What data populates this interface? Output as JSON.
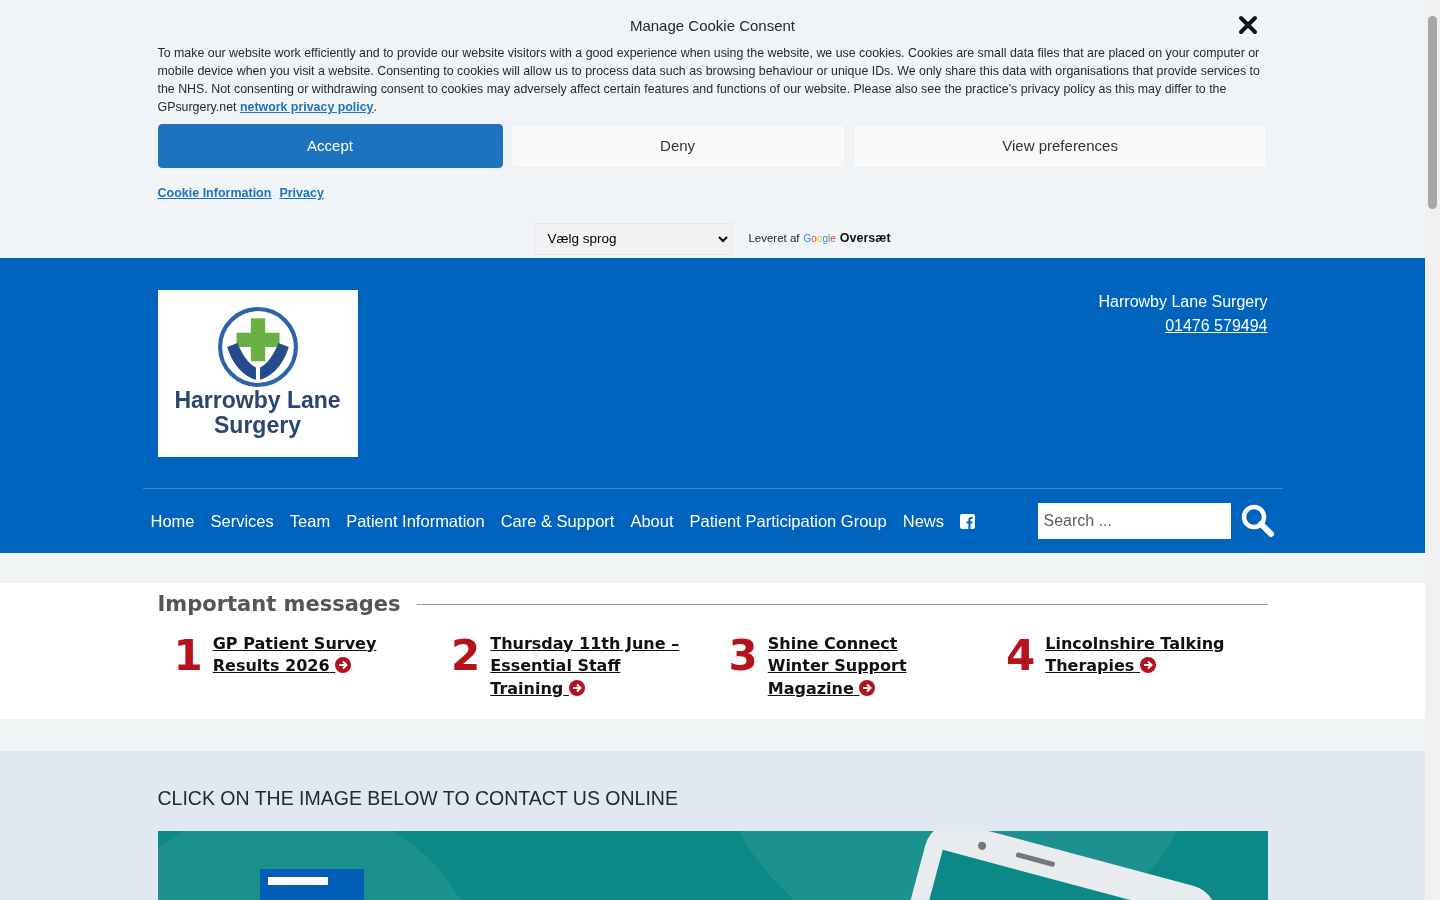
{
  "cookie_banner": {
    "title": "Manage Cookie Consent",
    "text_before": "To make our website work efficiently and to provide our website visitors with a good experience when using the website, we use cookies. Cookies are small data files that are placed on your computer or mobile device when you visit a website. Consenting to cookies will allow us to process data such as browsing behaviour or unique IDs. We only share this data with organisations that provide services to the NHS. Not consenting or withdrawing consent to cookies may adversely affect certain features and functions of our website. Please also see the practice’s privacy policy as this may differ to the GPsurgery.net ",
    "link": "network privacy policy",
    "text_after": ".",
    "buttons": [
      {
        "label": "Accept",
        "kind": "primary"
      },
      {
        "label": "Deny",
        "kind": "secondary"
      },
      {
        "label": "View preferences",
        "kind": "secondary"
      }
    ],
    "links": [
      "Cookie Information",
      "Privacy"
    ]
  },
  "translate": {
    "select_value": "Vælg sprog",
    "powered_by": "Leveret af",
    "provider": "Google",
    "action": "Oversæt"
  },
  "header": {
    "logo_lines": [
      "Harrowby Lane",
      "Surgery"
    ],
    "name": "Harrowby Lane Surgery",
    "phone": "01476 579494"
  },
  "nav": {
    "items": [
      "Home",
      "Services",
      "Team",
      "Patient Information",
      "Care & Support",
      "About",
      "Patient Participation Group",
      "News"
    ],
    "search_placeholder": "Search ..."
  },
  "messages": {
    "title": "Important messages",
    "items": [
      {
        "number": "1",
        "title": "GP Patient Survey Results 2026"
      },
      {
        "number": "2",
        "title": "Thursday 11th June – Essential Staff Training"
      },
      {
        "number": "3",
        "title": "Shine Connect Winter Support Magazine"
      },
      {
        "number": "4",
        "title": "Lincolnshire Talking Therapies"
      }
    ]
  },
  "contact": {
    "heading": "CLICK ON THE IMAGE BELOW TO CONTACT US ONLINE"
  }
}
